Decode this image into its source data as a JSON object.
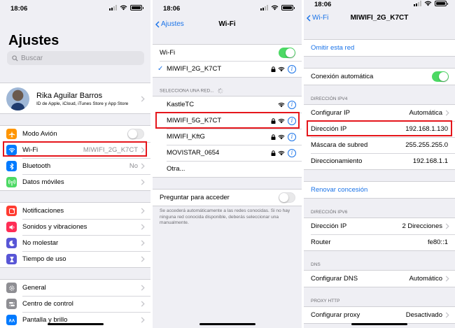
{
  "status": {
    "time": "18:06"
  },
  "settings": {
    "title": "Ajustes",
    "search_placeholder": "Buscar",
    "profile": {
      "name": "Rika Aguilar Barros",
      "subtitle": "ID de Apple, iCloud, iTunes Store y App Store"
    },
    "items": [
      {
        "label": "Modo Avión",
        "value": "",
        "color": "#ff9500",
        "icon": "airplane-icon"
      },
      {
        "label": "Wi-Fi",
        "value": "MIWIFI_2G_K7CT",
        "color": "#007aff",
        "icon": "wifi-icon"
      },
      {
        "label": "Bluetooth",
        "value": "No",
        "color": "#007aff",
        "icon": "bluetooth-icon"
      },
      {
        "label": "Datos móviles",
        "value": "",
        "color": "#4cd964",
        "icon": "antenna-icon"
      },
      {
        "label": "Notificaciones",
        "value": "",
        "color": "#ff3b30",
        "icon": "notifications-icon"
      },
      {
        "label": "Sonidos y vibraciones",
        "value": "",
        "color": "#ff2d55",
        "icon": "speaker-icon"
      },
      {
        "label": "No molestar",
        "value": "",
        "color": "#5856d6",
        "icon": "moon-icon"
      },
      {
        "label": "Tiempo de uso",
        "value": "",
        "color": "#5856d6",
        "icon": "hourglass-icon"
      },
      {
        "label": "General",
        "value": "",
        "color": "#8e8e93",
        "icon": "gear-icon"
      },
      {
        "label": "Centro de control",
        "value": "",
        "color": "#8e8e93",
        "icon": "switches-icon"
      },
      {
        "label": "Pantalla y brillo",
        "value": "",
        "color": "#007aff",
        "icon": "text-size-icon"
      }
    ]
  },
  "wifi": {
    "back": "Ajustes",
    "title": "Wi-Fi",
    "toggle_label": "Wi-Fi",
    "connected": "MIWIFI_2G_K7CT",
    "section_header": "SELECCIONA UNA RED...",
    "networks": [
      "KastleTC",
      "MIWIFI_5G_K7CT",
      "MIWIFI_KftG",
      "MOVISTAR_0654"
    ],
    "other": "Otra...",
    "ask_label": "Preguntar para acceder",
    "ask_note": "Se accederá automáticamente a las redes conocidas. Si no hay ninguna red conocida disponible, deberás seleccionar una manualmente."
  },
  "detail": {
    "back": "Wi-Fi",
    "title": "MIWIFI_2G_K7CT",
    "forget": "Omitir esta red",
    "autojoin": "Conexión automática",
    "ipv4_header": "DIRECCIÓN IPV4",
    "configure_ip": {
      "label": "Configurar IP",
      "value": "Automática"
    },
    "ip_address": {
      "label": "Dirección IP",
      "value": "192.168.1.130"
    },
    "subnet": {
      "label": "Máscara de subred",
      "value": "255.255.255.0"
    },
    "router": {
      "label": "Direccionamiento",
      "value": "192.168.1.1"
    },
    "renew": "Renovar concesión",
    "ipv6_header": "DIRECCIÓN IPV6",
    "ipv6_address": {
      "label": "Dirección IP",
      "value": "2 Direcciones"
    },
    "ipv6_router": {
      "label": "Router",
      "value": "fe80::1"
    },
    "dns_header": "DNS",
    "dns": {
      "label": "Configurar DNS",
      "value": "Automático"
    },
    "proxy_header": "PROXY HTTP",
    "proxy": {
      "label": "Configurar proxy",
      "value": "Desactivado"
    }
  },
  "colors": {
    "accent": "#1a73e8",
    "highlight": "#e5161c",
    "toggle_on": "#4cd964"
  }
}
